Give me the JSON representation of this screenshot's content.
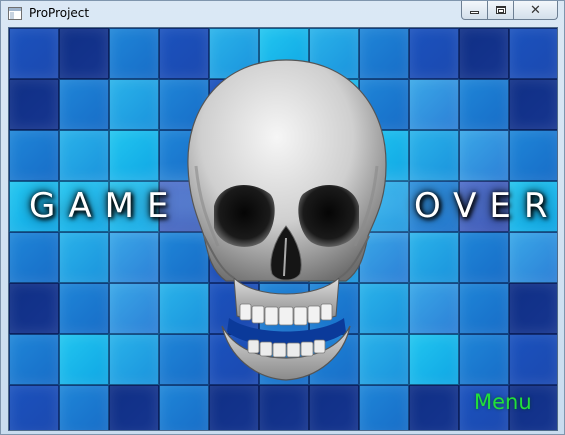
{
  "window": {
    "title": "ProProject",
    "buttons": [
      "minimize",
      "maximize",
      "close"
    ]
  },
  "game": {
    "message_left": "GAME",
    "message_right": "OVER",
    "menu_label": "Menu",
    "colors": {
      "menu_text": "#22e03a",
      "message_text": "#ffffff",
      "background": "#1d5fb8"
    },
    "background_tiles": [
      [
        1,
        0,
        2,
        1,
        3,
        6,
        3,
        2,
        1,
        0,
        1
      ],
      [
        0,
        2,
        3,
        2,
        1,
        3,
        6,
        2,
        4,
        2,
        0
      ],
      [
        2,
        3,
        6,
        2,
        1,
        2,
        3,
        6,
        3,
        4,
        2
      ],
      [
        6,
        6,
        6,
        5,
        2,
        3,
        6,
        3,
        2,
        5,
        6
      ],
      [
        2,
        3,
        4,
        2,
        1,
        2,
        3,
        4,
        3,
        2,
        4
      ],
      [
        0,
        2,
        4,
        3,
        1,
        2,
        2,
        3,
        4,
        2,
        0
      ],
      [
        2,
        6,
        3,
        2,
        1,
        2,
        2,
        3,
        6,
        2,
        1
      ],
      [
        1,
        2,
        0,
        2,
        0,
        0,
        0,
        2,
        0,
        1,
        0
      ]
    ],
    "icons": [
      "skull-image",
      "app-icon"
    ]
  }
}
